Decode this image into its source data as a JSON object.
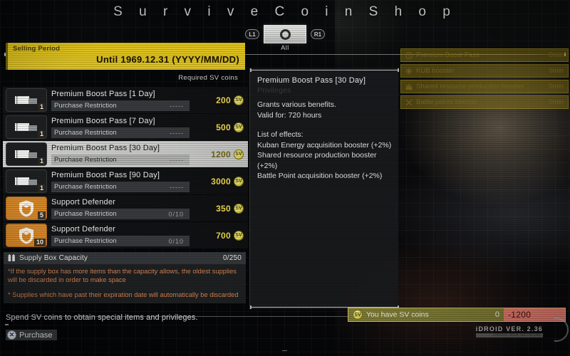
{
  "header": {
    "title": "S u r v i v e   C o i n   S h o p",
    "left_bumper": "L1",
    "right_bumper": "R1",
    "active_tab_label": "All",
    "tab_icon": "circle-ring-icon"
  },
  "selling_period": {
    "label": "Selling Period",
    "value": "Until 1969.12.31 (YYYY/MM/DD)"
  },
  "list": {
    "price_header": "Required SV  coins",
    "items": [
      {
        "name": "Premium Boost Pass [1 Day]",
        "restriction_label": "Purchase Restriction",
        "restriction_value": "-----",
        "price": "200",
        "icon": "ticket-icon",
        "qty": "1",
        "selected": false
      },
      {
        "name": "Premium Boost Pass [7 Day]",
        "restriction_label": "Purchase Restriction",
        "restriction_value": "-----",
        "price": "500",
        "icon": "ticket-icon",
        "qty": "1",
        "selected": false
      },
      {
        "name": "Premium Boost Pass [30 Day]",
        "restriction_label": "Purchase Restriction",
        "restriction_value": "-----",
        "price": "1200",
        "icon": "ticket-icon",
        "qty": "1",
        "selected": true
      },
      {
        "name": "Premium Boost Pass [90 Day]",
        "restriction_label": "Purchase Restriction",
        "restriction_value": "-----",
        "price": "3000",
        "icon": "ticket-icon",
        "qty": "1",
        "selected": false
      },
      {
        "name": "Support Defender",
        "restriction_label": "Purchase Restriction",
        "restriction_value": "0/10",
        "price": "350",
        "icon": "support-defender-icon",
        "qty": "5",
        "selected": false
      },
      {
        "name": "Support Defender",
        "restriction_label": "Purchase Restriction",
        "restriction_value": "0/10",
        "price": "700",
        "icon": "support-defender-icon",
        "qty": "10",
        "selected": false
      }
    ]
  },
  "supply_box": {
    "icon": "supply-box-icon",
    "label": "Supply Box Capacity",
    "capacity": "0/250",
    "note_1": "*If the supply box has more items than the capacity allows, the oldest supplies will be discarded in order to make space",
    "note_2": "* Supplies which have past their expiration date will automatically be discarded"
  },
  "spend_hint": "Spend SV  coins to obtain special items and privileges.",
  "detail": {
    "title": "Premium Boost Pass [30 Day]",
    "subtitle": "Privileges",
    "line_1": "Grants various benefits.",
    "line_2": "Valid for: 720 hours",
    "line_3": "List of effects:",
    "line_4": " Kuban Energy acquisition booster (+2%)",
    "line_5": " Shared resource production booster (+2%)",
    "line_6": " Battle Point acquisition booster (+2%)"
  },
  "active_buffs": [
    {
      "icon": "exclamation-icon",
      "label": "Premium Boost Pass",
      "value": "0min"
    },
    {
      "icon": "atom-icon",
      "label": "KUB booster",
      "value": "0min"
    },
    {
      "icon": "factory-icon",
      "label": "Shared resource production booster",
      "value": "0min"
    },
    {
      "icon": "crossed-swords-icon",
      "label": "Battle  points booster",
      "value": "0min"
    }
  ],
  "coin_bar": {
    "coin_icon": "sv-coin-icon",
    "label": "You have SV  coins",
    "amount": "0",
    "delta": "-1200"
  },
  "footer": {
    "purchase_button_icon": "playstation-cross-icon",
    "purchase_label": "Purchase",
    "idroid_version": "iDROID VER. 2.36",
    "idroid_sub": "iDROID WEB NETWORK"
  },
  "colors": {
    "selling_period_yellow": "#dcc020",
    "price_gold": "#ecd94f",
    "warning_orange": "#d7814e",
    "coin_bar_olive": "#7d7a32",
    "delta_red": "#e0766a",
    "support_defender_orange": "#d2862a"
  }
}
